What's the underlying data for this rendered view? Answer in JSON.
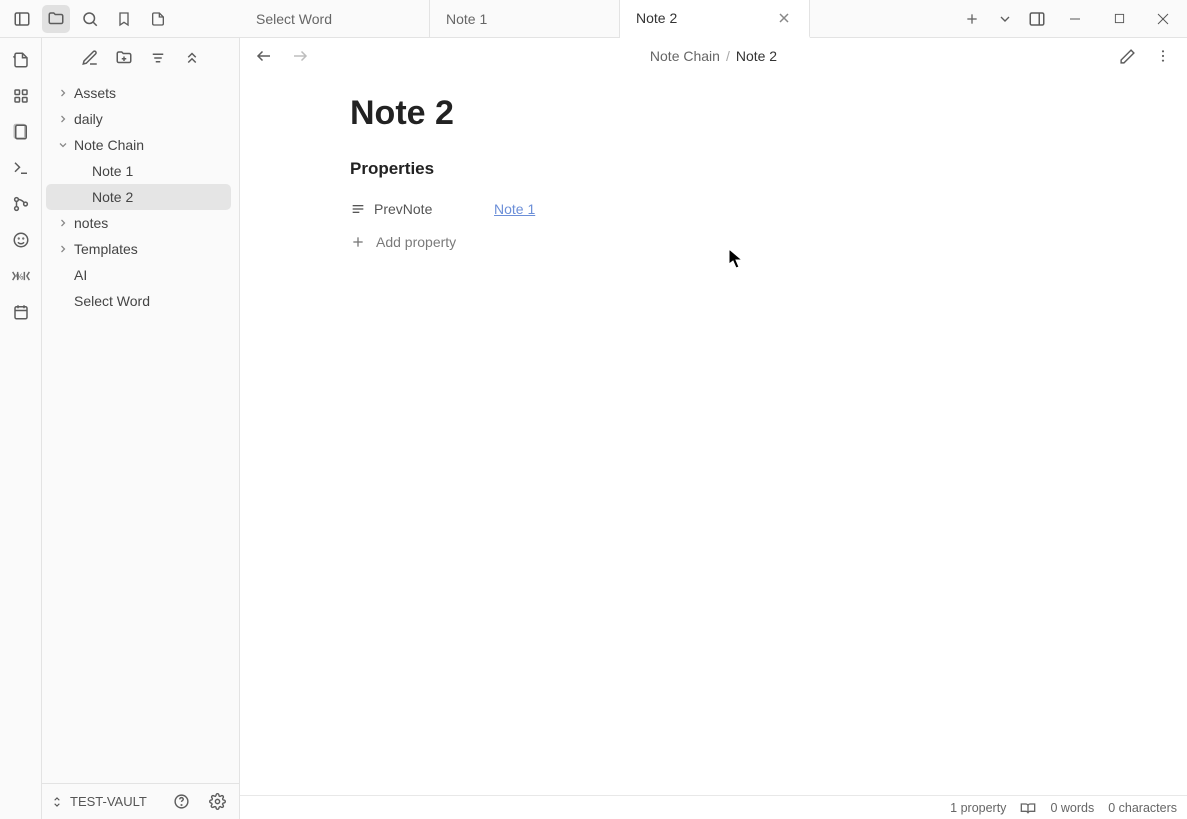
{
  "tabs": [
    {
      "label": "Select Word",
      "active": false
    },
    {
      "label": "Note 1",
      "active": false
    },
    {
      "label": "Note 2",
      "active": true
    }
  ],
  "breadcrumb": {
    "parent": "Note Chain",
    "current": "Note 2"
  },
  "doc": {
    "title": "Note 2",
    "properties_heading": "Properties",
    "prop_key": "PrevNote",
    "prop_link": "Note 1",
    "add_property": "Add property"
  },
  "tree": {
    "items": [
      {
        "label": "Assets",
        "depth": 0,
        "arrow": "right"
      },
      {
        "label": "daily",
        "depth": 0,
        "arrow": "right"
      },
      {
        "label": "Note Chain",
        "depth": 0,
        "arrow": "down"
      },
      {
        "label": "Note 1",
        "depth": 1,
        "arrow": ""
      },
      {
        "label": "Note 2",
        "depth": 1,
        "arrow": "",
        "selected": true
      },
      {
        "label": "notes",
        "depth": 0,
        "arrow": "right"
      },
      {
        "label": "Templates",
        "depth": 0,
        "arrow": "right"
      },
      {
        "label": "AI",
        "depth": 0,
        "arrow": ""
      },
      {
        "label": "Select Word",
        "depth": 0,
        "arrow": ""
      }
    ]
  },
  "vault_name": "TEST-VAULT",
  "status": {
    "properties": "1 property",
    "words": "0 words",
    "chars": "0 characters"
  }
}
